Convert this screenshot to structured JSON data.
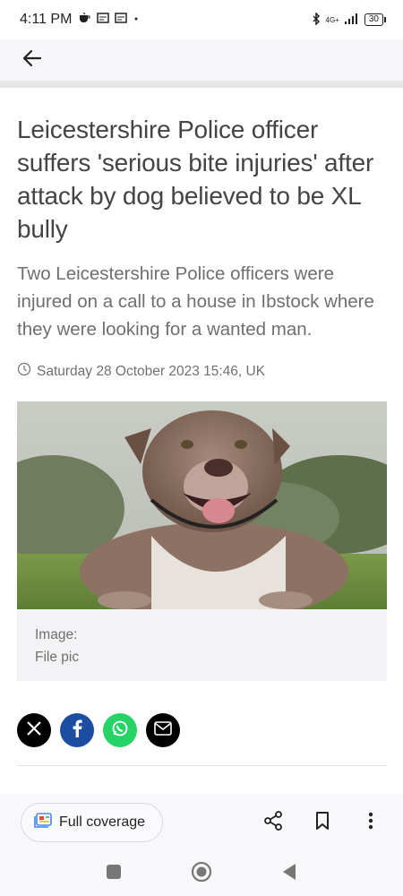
{
  "status_bar": {
    "time": "4:11 PM",
    "network": "4G+",
    "battery": "30"
  },
  "app_bar": {
    "back_icon": "arrow-left-icon"
  },
  "article": {
    "headline": "Leicestershire Police officer suffers 'serious bite injuries' after attack by dog believed to be XL bully",
    "standfirst": "Two Leicestershire Police officers were injured on a call to a house in Ibstock where they were looking for a wanted man.",
    "dateline": "Saturday 28 October 2023 15:46, UK",
    "caption_label": "Image:",
    "caption_text": "File pic"
  },
  "share": {
    "icons": [
      "x-icon",
      "facebook-icon",
      "whatsapp-icon",
      "email-icon"
    ]
  },
  "bottom_bar": {
    "full_coverage_label": "Full coverage",
    "actions": [
      "share-icon",
      "bookmark-icon",
      "more-vert-icon"
    ]
  },
  "nav_bar": {
    "buttons": [
      "recents-square-icon",
      "home-circle-icon",
      "back-triangle-icon"
    ]
  },
  "colors": {
    "facebook": "#1c4da1",
    "whatsapp": "#25d366",
    "headline": "#444444",
    "muted_text": "#6f6f6f"
  }
}
